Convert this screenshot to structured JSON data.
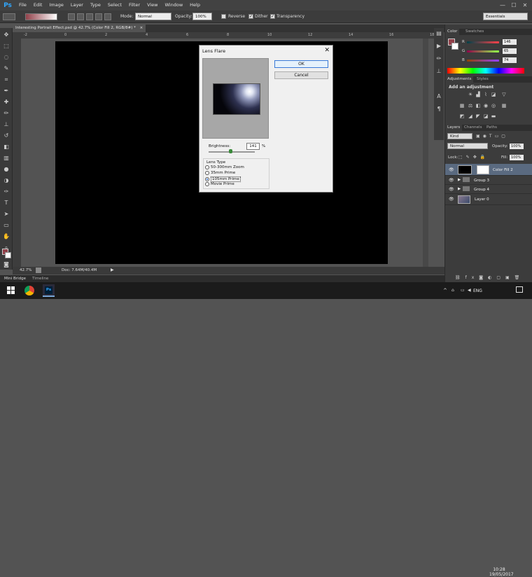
{
  "app": {
    "logo": "Ps"
  },
  "menu": [
    "File",
    "Edit",
    "Image",
    "Layer",
    "Type",
    "Select",
    "Filter",
    "View",
    "Window",
    "Help"
  ],
  "window_controls": {
    "minimize": "—",
    "maximize": "☐",
    "close": "✕"
  },
  "options_bar": {
    "mode_label": "Mode:",
    "mode_value": "Normal",
    "opacity_label": "Opacity:",
    "opacity_value": "100%",
    "reverse_label": "Reverse",
    "reverse_checked": false,
    "dither_label": "Dither",
    "dither_checked": true,
    "transparency_label": "Transparency",
    "transparency_checked": true,
    "workspace": "Essentials"
  },
  "document_tab": {
    "title": "Interesting Portrait Effect.psd @ 42.7% (Color Fill 2, RGB/8#) *",
    "close": "×"
  },
  "ruler_ticks": [
    "-2",
    "0",
    "2",
    "4",
    "6",
    "8",
    "10",
    "12",
    "14",
    "16",
    "18"
  ],
  "status_bar": {
    "zoom": "42.7%",
    "doc": "Doc: 7.64M/40.4M"
  },
  "bottom_tabs": [
    "Mini Bridge",
    "Timeline"
  ],
  "color_panel": {
    "tabs": [
      "Color",
      "Swatches"
    ],
    "channels": [
      {
        "label": "R",
        "value": "146"
      },
      {
        "label": "G",
        "value": "65"
      },
      {
        "label": "B",
        "value": "74"
      }
    ],
    "fg_color": "#92414a"
  },
  "adjustments_panel": {
    "tabs": [
      "Adjustments",
      "Styles"
    ],
    "heading": "Add an adjustment"
  },
  "layers_panel": {
    "tabs": [
      "Layers",
      "Channels",
      "Paths"
    ],
    "filter_kind": "Kind",
    "blend_mode": "Normal",
    "opacity_label": "Opacity:",
    "opacity_value": "100%",
    "lock_label": "Lock:",
    "fill_label": "Fill:",
    "fill_value": "100%",
    "layers": [
      {
        "name": "Color Fill 2",
        "type": "fill",
        "selected": true
      },
      {
        "name": "Group 3",
        "type": "group",
        "selected": false
      },
      {
        "name": "Group 4",
        "type": "group",
        "selected": false
      },
      {
        "name": "Layer 0",
        "type": "image",
        "selected": false
      }
    ]
  },
  "lens_flare_dialog": {
    "title": "Lens Flare",
    "close": "✕",
    "ok": "OK",
    "cancel": "Cancel",
    "brightness_label": "Brightness:",
    "brightness_value": "141",
    "brightness_unit": "%",
    "brightness_fraction": 0.47,
    "lens_type_label": "Lens Type",
    "lens_types": [
      {
        "label": "50-300mm Zoom",
        "selected": false
      },
      {
        "label": "35mm Prime",
        "selected": false
      },
      {
        "label": "105mm Prime",
        "selected": true
      },
      {
        "label": "Movie Prime",
        "selected": false
      }
    ]
  },
  "taskbar": {
    "time": "10:28",
    "date": "19/05/2017",
    "language": "ENG",
    "apps": [
      "windows-start",
      "chrome",
      "photoshop"
    ]
  },
  "colors": {
    "accent": "#31a8ff",
    "dialog_ok_border": "#3a7ad8",
    "selected_layer": "#5a6a80"
  }
}
